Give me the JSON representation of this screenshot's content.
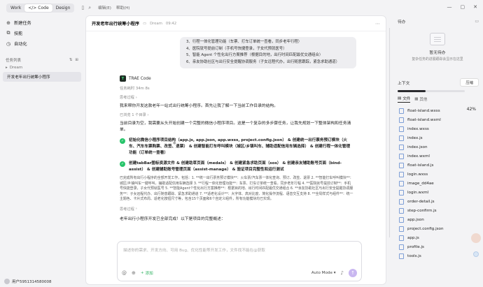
{
  "topbar": {
    "modes": [
      {
        "label": "Work",
        "active": false
      },
      {
        "label": "Code",
        "active": true
      },
      {
        "label": "Design",
        "active": false
      }
    ],
    "menu": [
      "编辑(E)",
      "帮助(H)"
    ]
  },
  "sidebar": {
    "nav": [
      {
        "label": "新建任务",
        "icon": "plus-icon"
      },
      {
        "label": "技能",
        "icon": "skill-icon"
      },
      {
        "label": "自动化",
        "icon": "clock-icon"
      }
    ],
    "task_list_label": "任务列表",
    "group_label": "Dream",
    "task_item": "开发老年出行统筹小程序",
    "user_name": "用户5951314580008"
  },
  "main": {
    "title": "开发老年出行统筹小程序",
    "workspace": "Dream",
    "time": "09:42",
    "user_bubble_lines": [
      "3、行程一体化管理功能（车票、打车订单统一查看，同步老年行程）",
      "4、医院就号提前订制（手机号快捷登录，子女代预就医号）",
      "5、智能 Agent 个性化出行方案推荐（根据目的地，出行时间匹配最优交通组合）",
      "6、亲友协助社区与出行安全提醒协调服务（子女远程代办，出行随意跟踪，紧急求助通道）"
    ],
    "agent_name": "TRAE Code",
    "elapsed": "任务耗时 34m 8s",
    "thought_label1": "思考过程",
    "intro": "我来帮你开发这款老年一站式出行统筹小程序。首先让我了解一下当前工作目录的结构。",
    "checked_label": "已浏览 1 个目录",
    "plan": "当前目录为空，我需要从头开始创建一个完整的微信小程序项目。这是一个复杂的多步骤任务，让我先规划一下整体架构和任务清单。",
    "todos": [
      "初始化微信小程序项目结构（app.js, app.json, app.wxss, project.config.json） & 创建统一出行票务预订模块（火车、汽车车票购票、改签、退票） & 创建智能打车呼叫模块（城区/乡镇叫车、辅助适配信用车辆选择） & 创建行程一体化管理功能（订单统一查看）",
      "创建tabBar图标资源文件 & 创建助草页面（medals） & 创建紧急求助页面（sos） & 创建亲友辅助账号页面（bind-assist） & 创建辅助账号管理页面（assist-manage） & 验证项目完整性和运行测试"
    ],
    "summary": "已完成所有出行小程序的全部开发工作，包括：1. **统一出行票务预订模块**：火车票/汽车票一体化查询、预订、改签、退票 2. **智能打车呼叫模块**：城区/乡镇叫车一键呼叫，辅助适配信用车辆选择 3. **行程一体化管理功能**：车票、打车订单统一查看，同步老年行程 4. **医院就号提前订制**：手机号快捷登录，子女代预就医号 5. **智能Agent个性化出行方案推荐**：根据目的地、出行时间匹配最优交通组合 6. **亲友协助社区与出行安全提醒协调服务**：子女远程代办、出行随意跟踪、紧急求助通道 7. **适老化设计**：大字体、高对比度、简化操作流程、语音交互支持 8. **全局样式与组件**：统一主题色、卡片式布局、适老化按钮尺寸等，包含15个页面和6个自定义组件，所有功能模块均已实现。",
    "thought_label2": "思考过程",
    "final": "老年出行小程序开发已全部完成！以下是项目的完整概述：",
    "input_placeholder": "描述你的需求、开发方向、可用 Bug、优化性能等开发工作，文件找不能在@获取",
    "add_context": "添加",
    "mode": "Auto Mode"
  },
  "right": {
    "todo_label": "待办",
    "empty_title": "暂无待办",
    "empty_sub": "复杂任务的进展跟踪会显示在这里",
    "context_label": "上下文",
    "compress_label": "压缩",
    "context_percent": "42%",
    "context_fraction": 0.42,
    "tabs": [
      {
        "label": "文件",
        "active": true
      },
      {
        "label": "其他",
        "active": false
      }
    ],
    "files": [
      "float-island.wxss",
      "float-island.wxml",
      "index.wxss",
      "index.js",
      "index.json",
      "index.wxml",
      "float-island.js",
      "login.wxss",
      "image_dd4ae",
      "login.wxml",
      "order-detail.js",
      "step-confirm.js",
      "app.json",
      "project.config.json",
      "app.js",
      "profile.js",
      "tools.js"
    ]
  }
}
